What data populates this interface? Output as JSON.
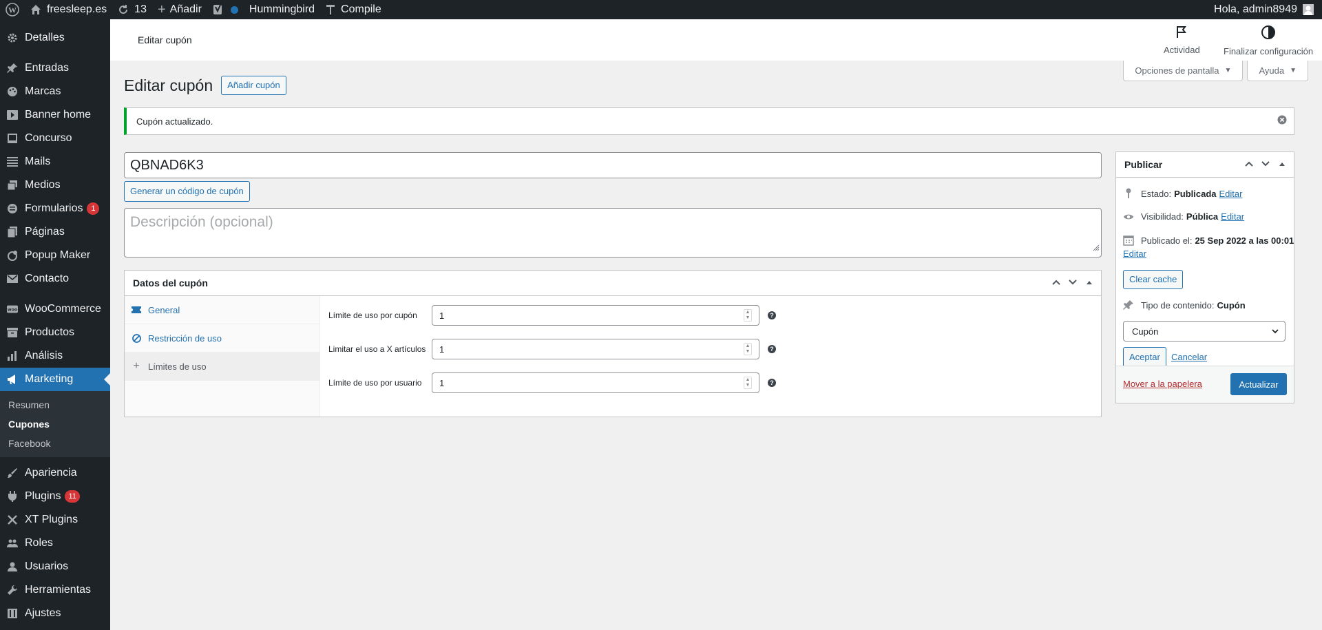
{
  "adminbar": {
    "site_name": "freesleep.es",
    "updates_count": "13",
    "add_label": "Añadir",
    "hummingbird_label": "Hummingbird",
    "compile_label": "Compile",
    "greeting": "Hola, admin8949"
  },
  "sidebar": {
    "items": [
      {
        "label": "Detalles",
        "icon": "gear-icon"
      },
      {
        "label": "Entradas",
        "icon": "pin-icon"
      },
      {
        "label": "Marcas",
        "icon": "palette-icon"
      },
      {
        "label": "Banner home",
        "icon": "play-icon"
      },
      {
        "label": "Concurso",
        "icon": "media-icon"
      },
      {
        "label": "Mails",
        "icon": "list-icon"
      },
      {
        "label": "Medios",
        "icon": "media-library-icon"
      },
      {
        "label": "Formularios",
        "icon": "forms-icon",
        "badge": "1"
      },
      {
        "label": "Páginas",
        "icon": "pages-icon"
      },
      {
        "label": "Popup Maker",
        "icon": "popup-icon"
      },
      {
        "label": "Contacto",
        "icon": "mail-icon"
      },
      {
        "label": "WooCommerce",
        "icon": "woo-icon"
      },
      {
        "label": "Productos",
        "icon": "archive-icon"
      },
      {
        "label": "Análisis",
        "icon": "bar-chart-icon"
      },
      {
        "label": "Marketing",
        "icon": "megaphone-icon"
      },
      {
        "label": "Apariencia",
        "icon": "brush-icon"
      },
      {
        "label": "Plugins",
        "icon": "plug-icon",
        "badge": "11"
      },
      {
        "label": "XT Plugins",
        "icon": "xt-icon"
      },
      {
        "label": "Roles",
        "icon": "users-group-icon"
      },
      {
        "label": "Usuarios",
        "icon": "user-icon"
      },
      {
        "label": "Herramientas",
        "icon": "wrench-icon"
      },
      {
        "label": "Ajustes",
        "icon": "settings-icon"
      }
    ],
    "submenu": [
      "Resumen",
      "Cupones",
      "Facebook"
    ]
  },
  "header": {
    "title": "Editar cupón",
    "activity_label": "Actividad",
    "finish_setup_label": "Finalizar configuración"
  },
  "page": {
    "title": "Editar cupón",
    "add_coupon_label": "Añadir cupón",
    "screen_options_label": "Opciones de pantalla",
    "help_label": "Ayuda",
    "notice": "Cupón actualizado.",
    "coupon_code": "QBNAD6K3",
    "generate_label": "Generar un código de cupón",
    "description_placeholder": "Descripción (opcional)"
  },
  "coupon_data": {
    "title": "Datos del cupón",
    "tabs": [
      {
        "label": "General",
        "icon": "ticket-icon"
      },
      {
        "label": "Restricción de uso",
        "icon": "no-entry-icon"
      },
      {
        "label": "Límites de uso",
        "icon": "plus-icon"
      }
    ],
    "fields": [
      {
        "label": "Límite de uso por cupón",
        "value": "1"
      },
      {
        "label": "Limitar el uso a X artículos",
        "value": "1"
      },
      {
        "label": "Límite de uso por usuario",
        "value": "1"
      }
    ]
  },
  "publish": {
    "title": "Publicar",
    "status_label": "Estado:",
    "status_value": "Publicada",
    "visibility_label": "Visibilidad:",
    "visibility_value": "Pública",
    "published_label": "Publicado el:",
    "published_value": "25 Sep 2022 a las 00:01",
    "edit_label": "Editar",
    "clear_cache_label": "Clear cache",
    "content_type_label": "Tipo de contenido:",
    "content_type_value": "Cupón",
    "select_value": "Cupón",
    "accept_label": "Aceptar",
    "cancel_label": "Cancelar",
    "trash_label": "Mover a la papelera",
    "update_label": "Actualizar"
  },
  "colors": {
    "accent": "#2271b1",
    "sidebar_bg": "#1d2327",
    "notice_success": "#00a32a",
    "badge": "#d63638"
  }
}
